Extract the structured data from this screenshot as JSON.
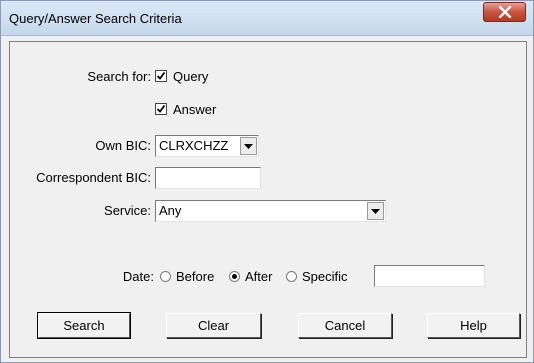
{
  "window": {
    "title": "Query/Answer Search Criteria",
    "close_icon": "close-x-icon"
  },
  "search_for": {
    "label": "Search for:",
    "query": {
      "label": "Query",
      "checked": true
    },
    "answer": {
      "label": "Answer",
      "checked": true
    }
  },
  "own_bic": {
    "label": "Own BIC:",
    "value": "CLRXCHZZ"
  },
  "correspondent_bic": {
    "label": "Correspondent BIC:",
    "value": ""
  },
  "service": {
    "label": "Service:",
    "value": "Any"
  },
  "date": {
    "label": "Date:",
    "options": [
      {
        "label": "Before",
        "selected": false
      },
      {
        "label": "After",
        "selected": true
      },
      {
        "label": "Specific",
        "selected": false
      }
    ],
    "value": ""
  },
  "buttons": {
    "search": "Search",
    "clear": "Clear",
    "cancel": "Cancel",
    "help": "Help"
  },
  "colors": {
    "close_button": "#c9543d",
    "titlebar": "#c6d7ec"
  }
}
